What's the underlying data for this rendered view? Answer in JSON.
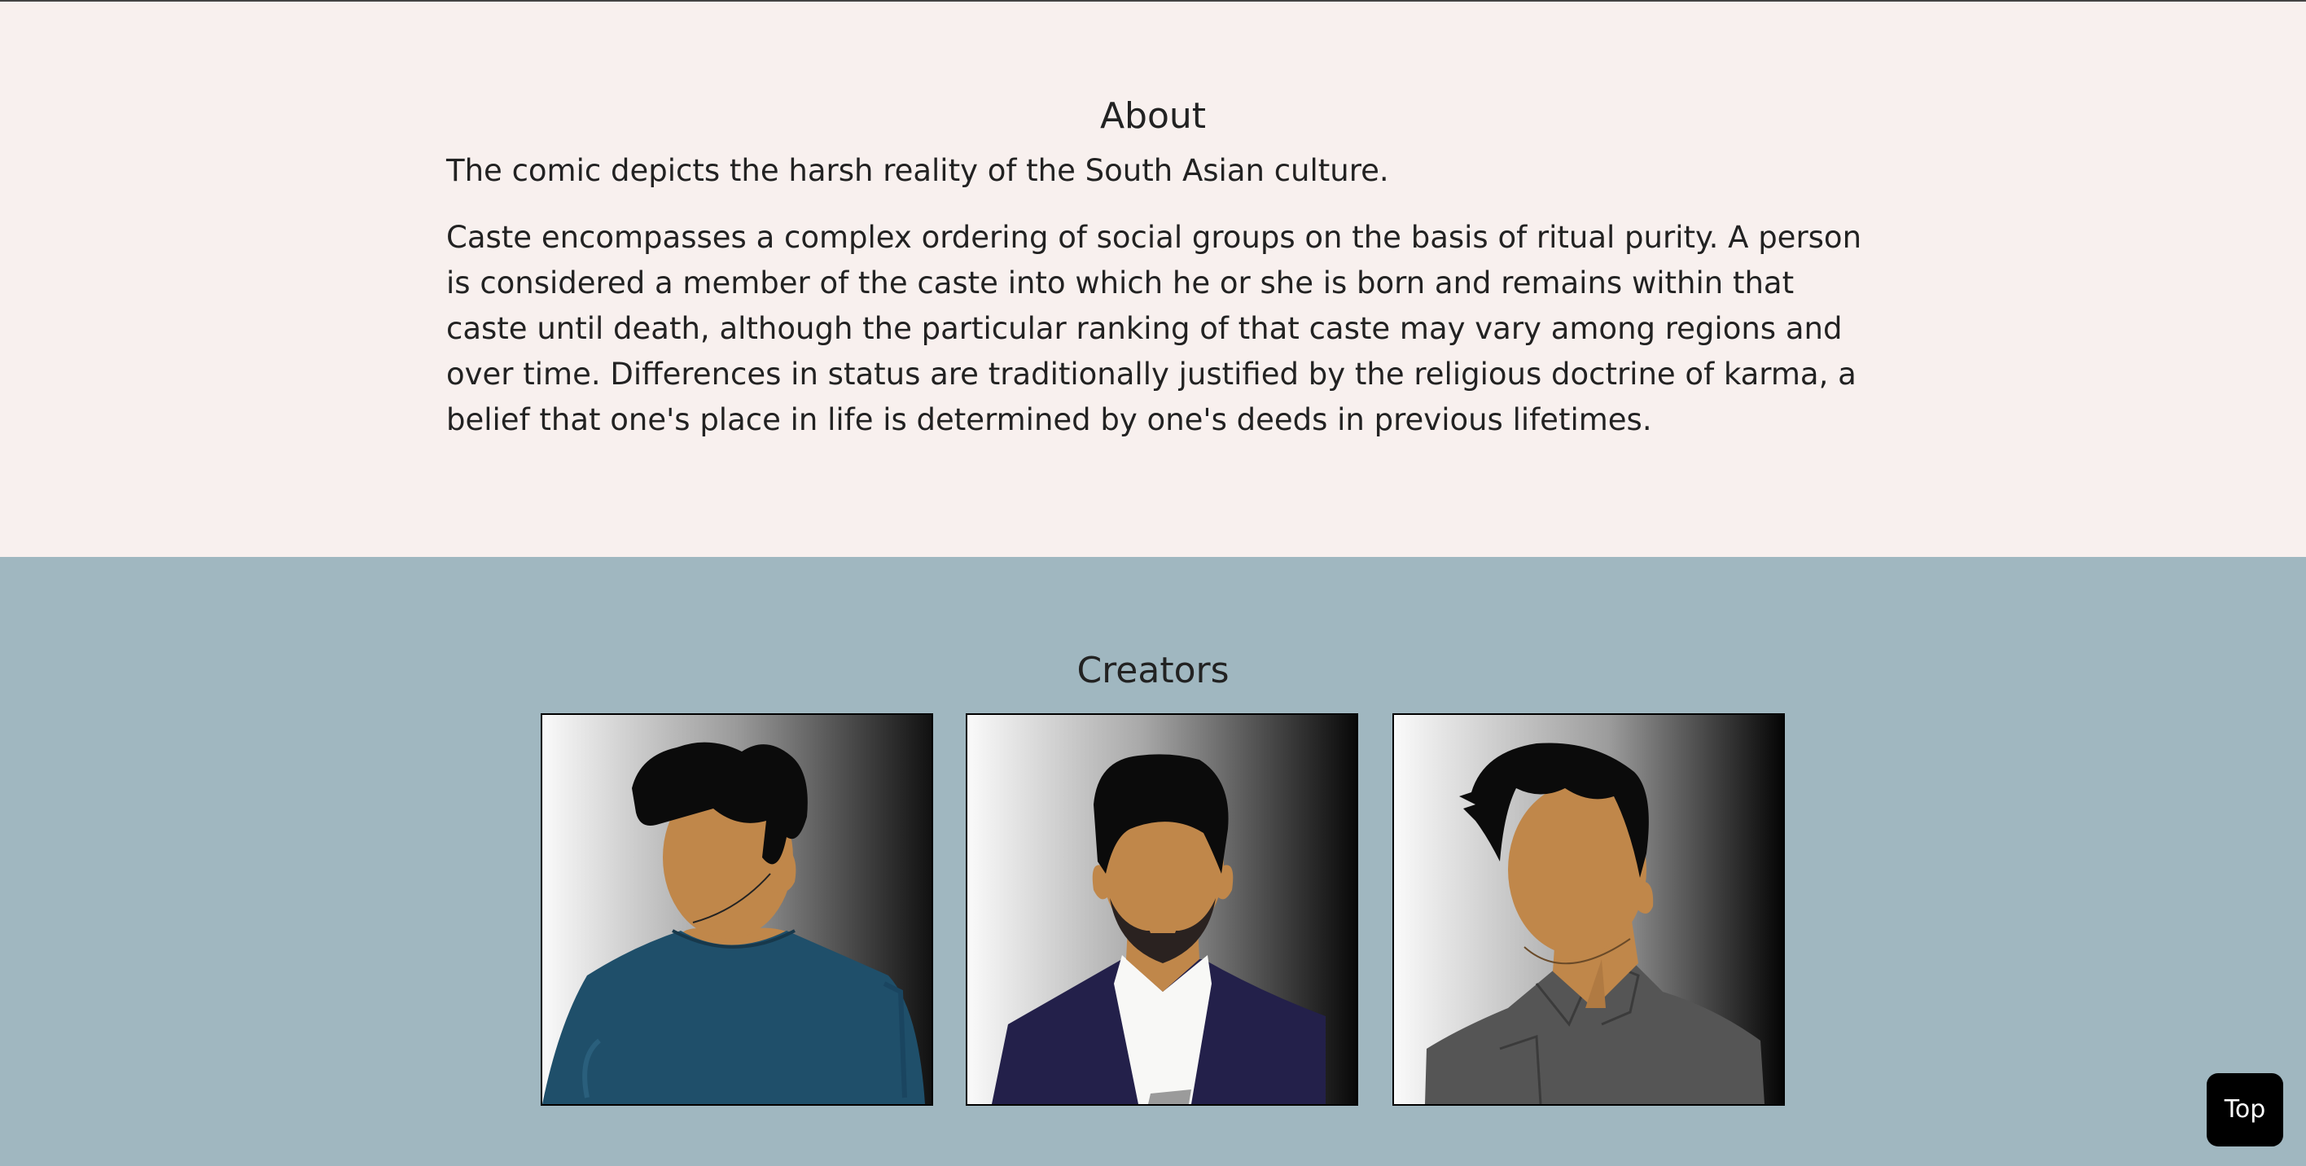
{
  "about": {
    "title": "About",
    "lead": "The comic depicts the harsh reality of the South Asian culture.",
    "body": "Caste encompasses a complex ordering of social groups on the basis of ritual purity. A person is considered a member of the caste into which he or she is born and remains within that caste until death, although the particular ranking of that caste may vary among regions and over time. Differences in status are traditionally justified by the religious doctrine of karma, a belief that one's place in life is determined by one's deeds in previous lifetimes."
  },
  "creators": {
    "title": "Creators",
    "portraits": [
      {
        "shirt_color": "#1f4f6a",
        "hair": "curly"
      },
      {
        "shirt_color": "#23204a",
        "hair": "beard"
      },
      {
        "shirt_color": "#555555",
        "hair": "messy"
      }
    ]
  },
  "top_button": {
    "label": "Top"
  },
  "colors": {
    "about_bg": "#f8f0ee",
    "creators_bg": "#a0b7c0",
    "skin": "#c0874a"
  }
}
